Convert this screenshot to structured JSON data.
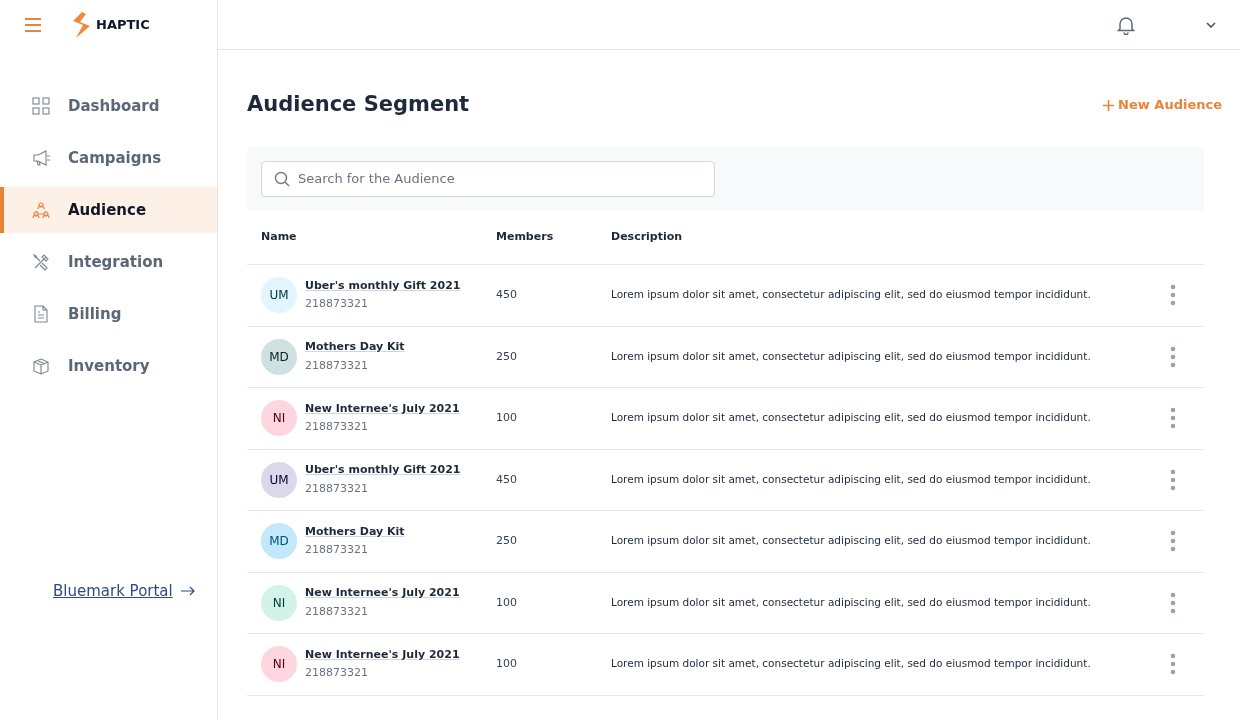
{
  "brand": "HAPTIC",
  "nav": [
    {
      "label": "Dashboard",
      "selected": false
    },
    {
      "label": "Campaigns",
      "selected": false
    },
    {
      "label": "Audience",
      "selected": true
    },
    {
      "label": "Integration",
      "selected": false
    },
    {
      "label": "Billing",
      "selected": false
    },
    {
      "label": "Inventory",
      "selected": false
    }
  ],
  "portal_link": "Bluemark Portal",
  "title": "Audience Segment",
  "new_button": "New Audience",
  "search": {
    "placeholder": "Search for the Audience"
  },
  "columns": [
    "Name",
    "Members",
    "Description"
  ],
  "rows": [
    {
      "initials": "UM",
      "color": "#e0f6fc",
      "name": "Uber's monthly Gift 2021",
      "id": "218873321",
      "members": "450",
      "description": "Lorem ipsum dolor sit amet, consectetur adipiscing elit, sed do eiusmod tempor incididunt."
    },
    {
      "initials": "MD",
      "color": "#cfe0e0",
      "name": "Mothers Day Kit",
      "id": "218873321",
      "members": "250",
      "description": "Lorem ipsum dolor sit amet, consectetur adipiscing elit, sed do eiusmod tempor incididunt."
    },
    {
      "initials": "NI",
      "color": "#fdd6e0",
      "name": "New Internee's July 2021",
      "id": "218873321",
      "members": "100",
      "description": "Lorem ipsum dolor sit amet, consectetur adipiscing elit, sed do eiusmod tempor incididunt."
    },
    {
      "initials": "UM",
      "color": "#dcd8ec",
      "name": "Uber's monthly Gift 2021",
      "id": "218873321",
      "members": "450",
      "description": "Lorem ipsum dolor sit amet, consectetur adipiscing elit, sed do eiusmod tempor incididunt."
    },
    {
      "initials": "MD",
      "color": "#c3e7fb",
      "name": "Mothers Day Kit",
      "id": "218873321",
      "members": "250",
      "description": "Lorem ipsum dolor sit amet, consectetur adipiscing elit, sed do eiusmod tempor incididunt."
    },
    {
      "initials": "NI",
      "color": "#d3f2ea",
      "name": "New Internee's July 2021",
      "id": "218873321",
      "members": "100",
      "description": "Lorem ipsum dolor sit amet, consectetur adipiscing elit, sed do eiusmod tempor incididunt."
    },
    {
      "initials": "NI",
      "color": "#fdd6e0",
      "name": "New Internee's July 2021",
      "id": "218873321",
      "members": "100",
      "description": "Lorem ipsum dolor sit amet, consectetur adipiscing elit, sed do eiusmod tempor incididunt."
    }
  ]
}
